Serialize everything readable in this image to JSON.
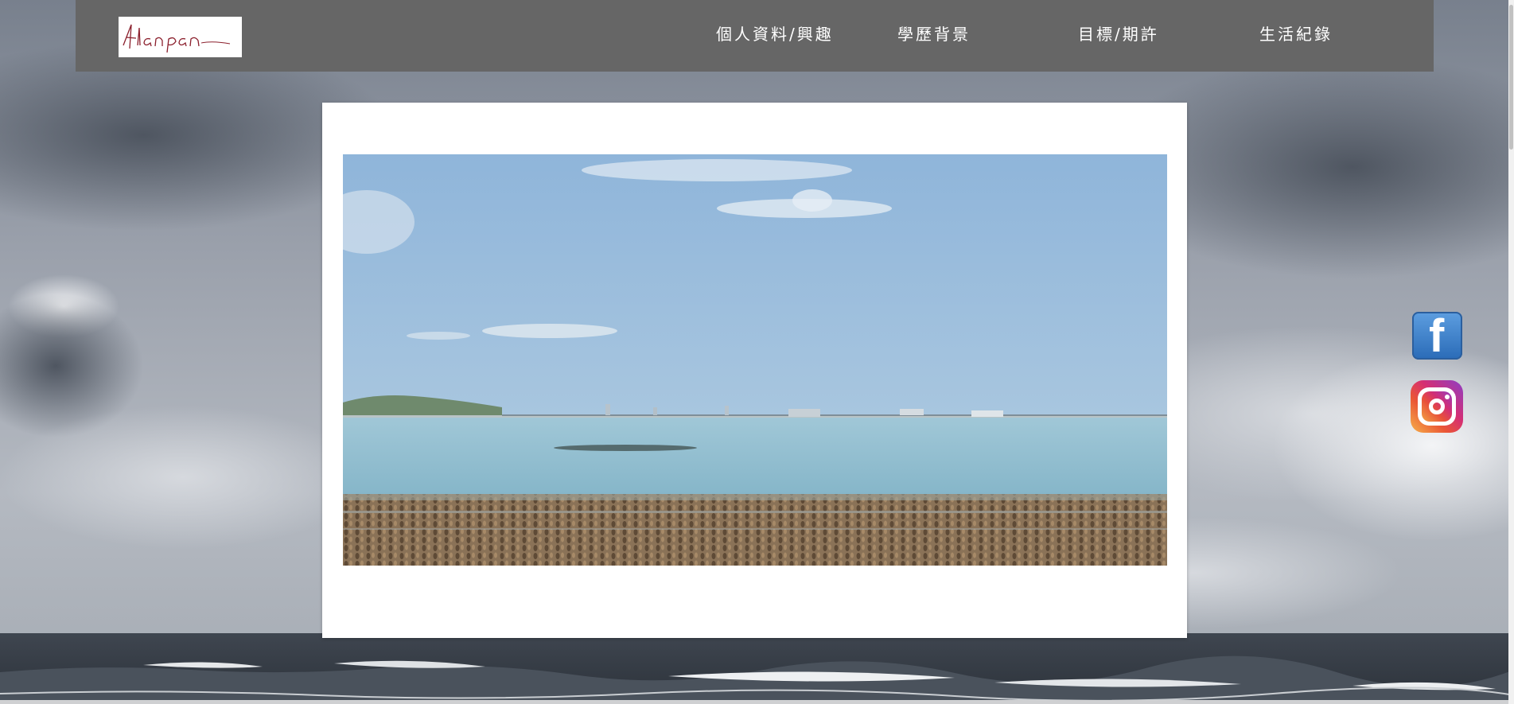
{
  "header": {
    "logo_text": "Alanpan",
    "nav": [
      {
        "label": "個人資料/興趣"
      },
      {
        "label": "學歷背景"
      },
      {
        "label": "目標/期許"
      },
      {
        "label": "生活紀錄"
      }
    ]
  },
  "social": {
    "facebook_icon": "facebook-icon",
    "instagram_icon": "instagram-icon",
    "facebook_glyph": "f"
  },
  "colors": {
    "header_bg": "#666666",
    "card_bg": "#ffffff",
    "nav_text": "#ffffff",
    "logo_ink": "#8b1f2c",
    "facebook_blue": "#3b79c4"
  }
}
